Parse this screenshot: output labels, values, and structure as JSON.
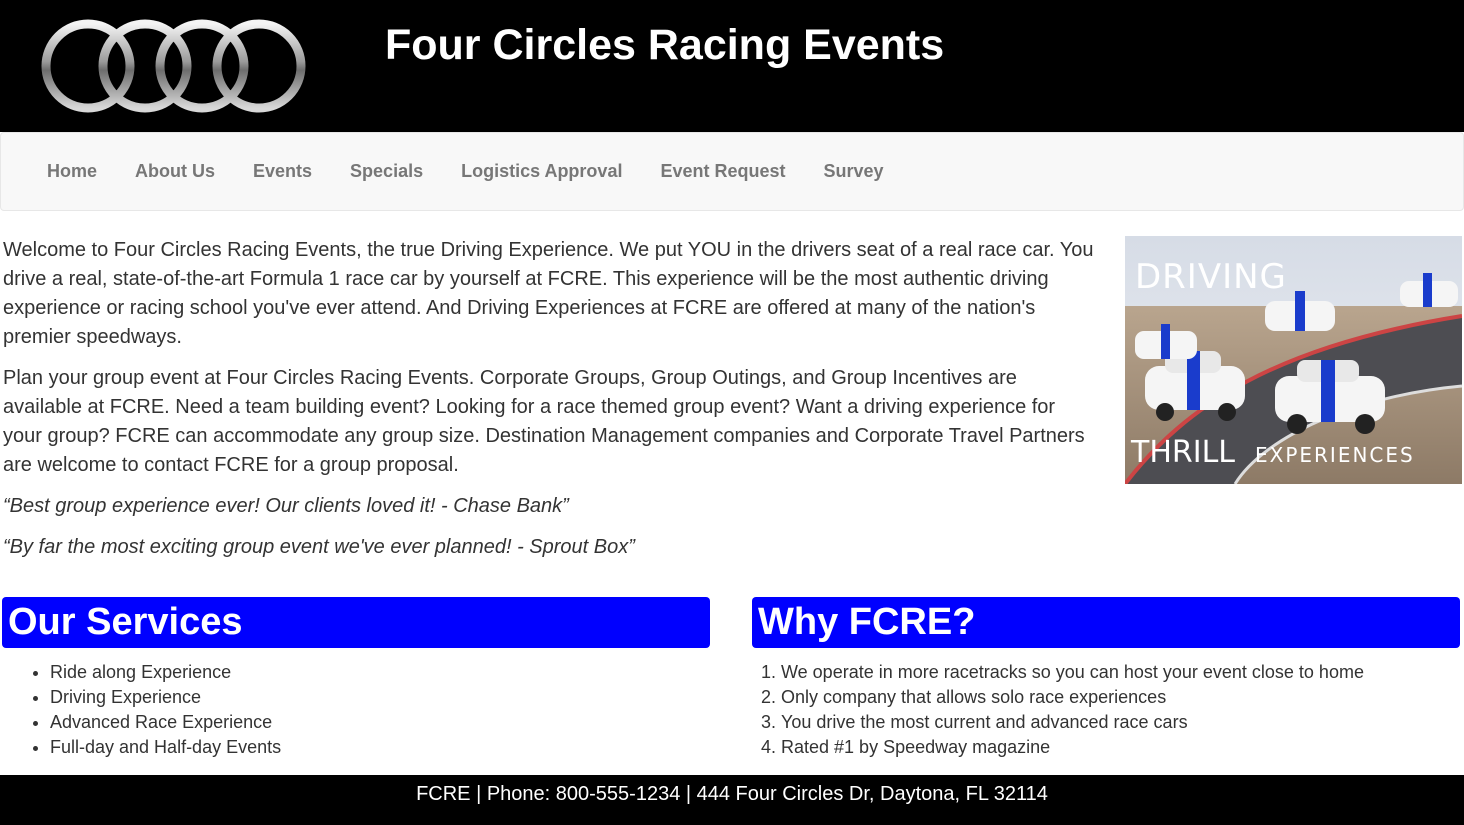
{
  "header": {
    "title": "Four Circles Racing Events",
    "logo_icon": "four-rings-logo-icon"
  },
  "nav": {
    "items": [
      {
        "label": "Home"
      },
      {
        "label": "About Us"
      },
      {
        "label": "Events"
      },
      {
        "label": "Specials"
      },
      {
        "label": "Logistics Approval"
      },
      {
        "label": "Event Request"
      },
      {
        "label": "Survey"
      }
    ]
  },
  "intro": {
    "paragraph1": "Welcome to Four Circles Racing Events, the true Driving Experience. We put YOU in the drivers seat of a real race car. You drive a real, state-of-the-art Formula 1 race car by yourself at FCRE. This experience will be the most authentic driving experience or racing school you've ever attend. And Driving Experiences at FCRE are offered at many of the nation's premier speedways.",
    "paragraph2": "Plan your group event at Four Circles Racing Events. Corporate Groups, Group Outings, and Group Incentives are available at FCRE. Need a team building event? Looking for a race themed group event? Want a driving experience for your group? FCRE can accommodate any group size. Destination Management companies and Corporate Travel Partners are welcome to contact FCRE for a group proposal.",
    "quote1": "“Best group experience ever! Our clients loved it! - Chase Bank”",
    "quote2": "“By far the most exciting group event we've ever planned! - Sprout Box”"
  },
  "hero": {
    "line1": "DRIVING",
    "line2_a": "THRILL",
    "line2_b": "EXPERIENCES"
  },
  "services": {
    "heading": "Our Services",
    "items": [
      "Ride along Experience",
      "Driving Experience",
      "Advanced Race Experience",
      "Full-day and Half-day Events"
    ]
  },
  "why": {
    "heading": "Why FCRE?",
    "items": [
      "We operate in more racetracks so you can host your event close to home",
      "Only company that allows solo race experiences",
      "You drive the most current and advanced race cars",
      "Rated #1 by Speedway magazine"
    ]
  },
  "footer": {
    "text": "FCRE | Phone: 800-555-1234 | 444 Four Circles Dr, Daytona, FL 32114"
  },
  "colors": {
    "header_bg": "#000000",
    "nav_bg": "#f8f8f8",
    "heading_blue": "#0000ff",
    "footer_bg": "#000000"
  }
}
